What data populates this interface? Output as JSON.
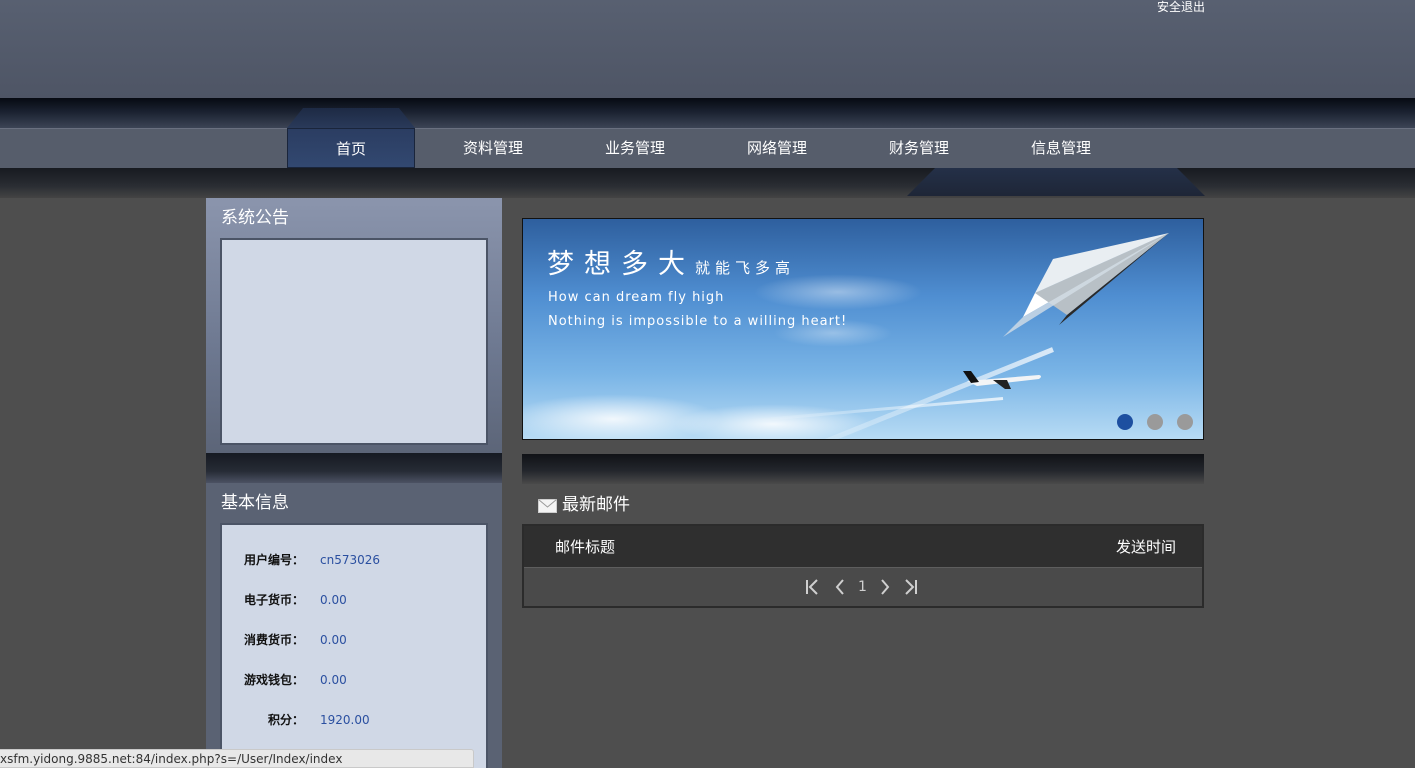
{
  "header": {
    "logout_label": "安全退出"
  },
  "nav": {
    "items": [
      {
        "label": "首页"
      },
      {
        "label": "资料管理"
      },
      {
        "label": "业务管理"
      },
      {
        "label": "网络管理"
      },
      {
        "label": "财务管理"
      },
      {
        "label": "信息管理"
      }
    ],
    "active_index": 0
  },
  "notice_panel": {
    "title": "系统公告"
  },
  "info_panel": {
    "title": "基本信息",
    "rows": [
      {
        "label": "用户编号：",
        "value": "cn573026"
      },
      {
        "label": "电子货币：",
        "value": "0.00"
      },
      {
        "label": "消费货币：",
        "value": "0.00"
      },
      {
        "label": "游戏钱包：",
        "value": "0.00"
      },
      {
        "label": "积分：",
        "value": "1920.00"
      }
    ]
  },
  "banner": {
    "title_large": "梦想多大",
    "title_small": "就能飞多高",
    "line1": "How can dream fly high",
    "line2": "Nothing is impossible to a willing heart!",
    "slide_count": 3,
    "active_slide": 0
  },
  "mail": {
    "heading": "最新邮件",
    "columns": {
      "title": "邮件标题",
      "time": "发送时间"
    },
    "current_page": "1"
  },
  "status_bar": {
    "url": "xsfm.yidong.9885.net:84/index.php?s=/User/Index/index"
  },
  "colors": {
    "header_bg": "#586071",
    "nav_active": "#2b3d62",
    "page_bg": "#4e4e4e",
    "panel_box": "#d0d8e6",
    "value_text": "#2a4fa0",
    "dot_active": "#1d4fa0"
  }
}
